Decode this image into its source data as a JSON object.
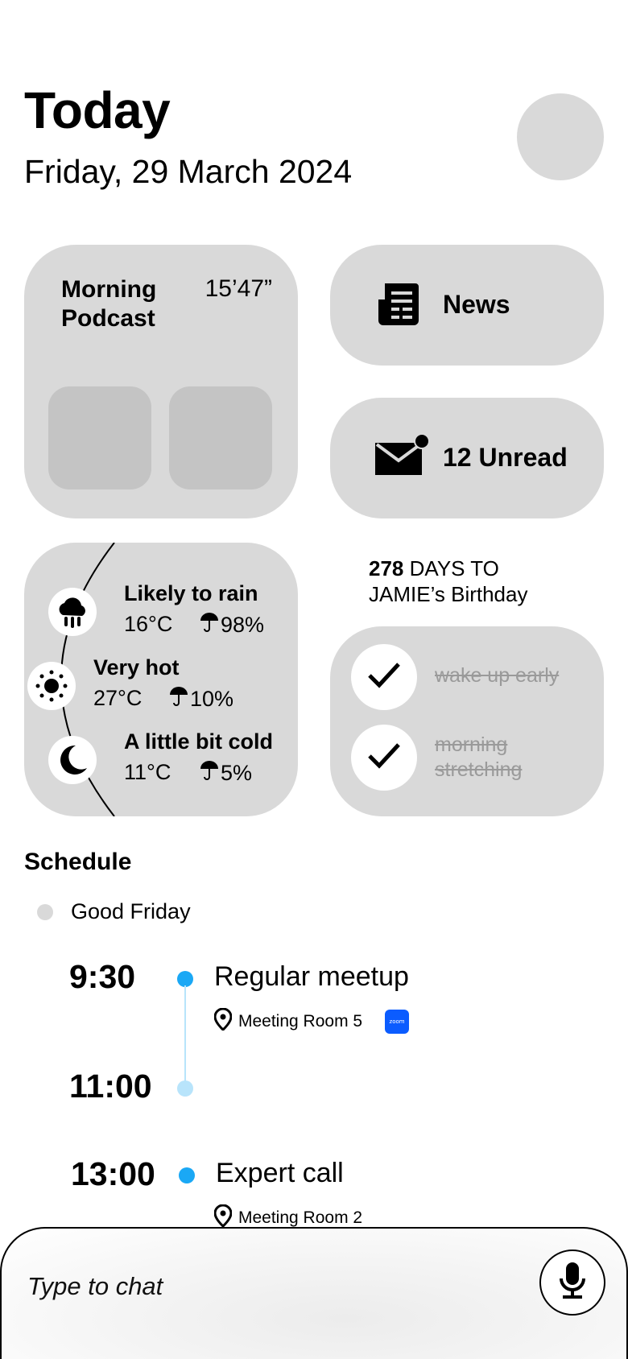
{
  "header": {
    "title": "Today",
    "date": "Friday, 29 March 2024"
  },
  "podcast": {
    "title": "Morning Podcast",
    "duration": "15’47”"
  },
  "news": {
    "label": "News",
    "icon": "newspaper-icon"
  },
  "mail": {
    "label": "12 Unread",
    "icon": "mail-icon"
  },
  "weather": {
    "items": [
      {
        "icon": "rain-cloud-icon",
        "title": "Likely to rain",
        "temp": "16°C",
        "rain": "98%"
      },
      {
        "icon": "sun-icon",
        "title": "Very hot",
        "temp": "27°C",
        "rain": "10%"
      },
      {
        "icon": "moon-icon",
        "title": "A little bit cold",
        "temp": "11°C",
        "rain": "5%"
      }
    ]
  },
  "countdown": {
    "days": "278",
    "text_line1": "DAYS TO",
    "text_line2": "JAMIE’s Birthday"
  },
  "todos": [
    {
      "label": "wake up early",
      "done": true
    },
    {
      "label_line1": "morning",
      "label_line2": "stretching",
      "done": true
    }
  ],
  "schedule": {
    "title": "Schedule",
    "holiday": "Good Friday",
    "events": [
      {
        "time": "9:30",
        "title": "Regular meetup",
        "location": "Meeting Room 5",
        "app": "zoom"
      },
      {
        "time": "11:00"
      },
      {
        "time": "13:00",
        "title": "Expert call",
        "location": "Meeting Room 2"
      }
    ]
  },
  "chat": {
    "placeholder": "Type to chat"
  },
  "colors": {
    "card": "#d9d9d9",
    "accent": "#1aa8f5",
    "accent_light": "#b8e4fb",
    "zoom": "#0b5cff"
  }
}
